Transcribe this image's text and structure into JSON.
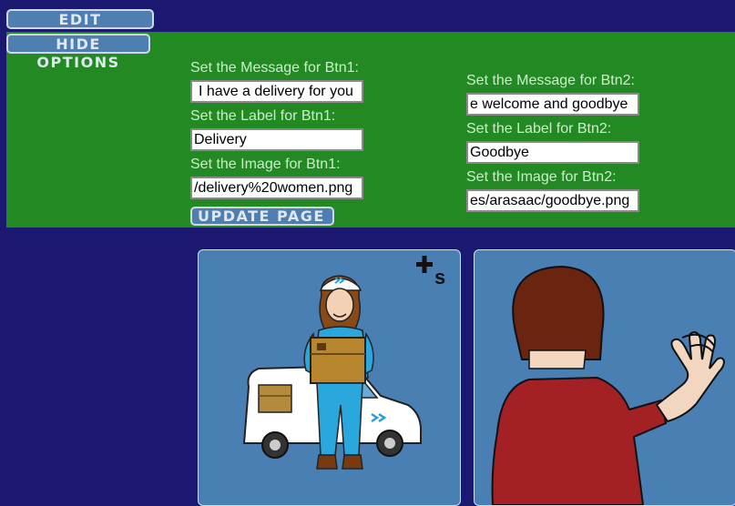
{
  "colors": {
    "background": "#1a1870",
    "panel": "#238a23",
    "button": "#4f7fb0",
    "card": "#4a7fb4"
  },
  "toolbar": {
    "edit_label": "EDIT BUTTONS",
    "hide_label": "HIDE OPTIONS"
  },
  "btn1": {
    "message_label": "Set the Message for Btn1:",
    "message_value": "I have a delivery for you",
    "label_label": "Set the Label for Btn1:",
    "label_value": "Delivery",
    "image_label": "Set the Image for Btn1:",
    "image_value": "/delivery%20women.png"
  },
  "btn2": {
    "message_label": "Set the Message for Btn2:",
    "message_value": "e welcome and goodbye",
    "label_label": "Set the Label for Btn2:",
    "label_value": "Goodbye",
    "image_label": "Set the Image for Btn2:",
    "image_value": "es/arasaac/goodbye.png"
  },
  "update_label": "UPDATE PAGE",
  "cards": {
    "card1_icon": "delivery-woman-icon",
    "card1_badge": "plural-badge-icon",
    "card2_icon": "waving-goodbye-icon"
  }
}
